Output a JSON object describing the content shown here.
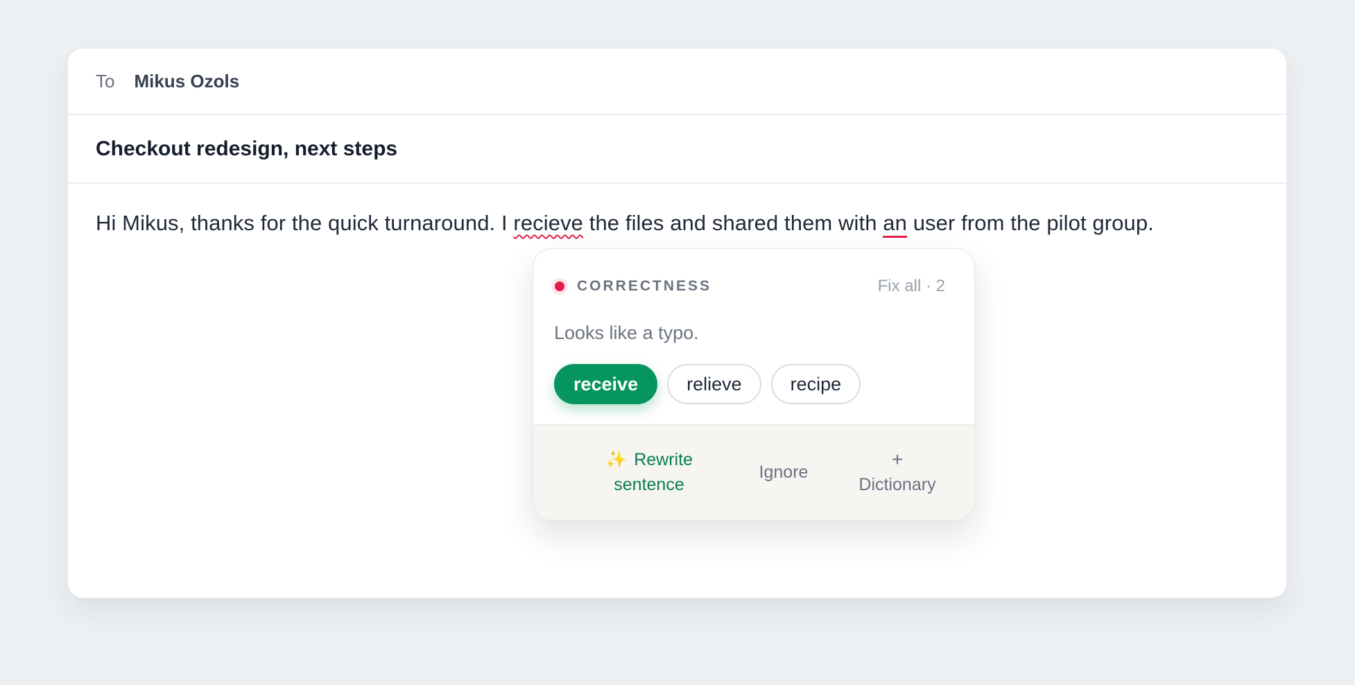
{
  "email": {
    "to_label": "To",
    "recipient": "Mikus Ozols",
    "subject": "Checkout redesign, next steps",
    "body": {
      "part1": "Hi Mikus, thanks for the quick turnaround. I ",
      "misspelled_word": "recieve",
      "part2": " the files and shared them with ",
      "grammar_word": "an",
      "part3": " user from the pilot group."
    }
  },
  "suggestion_card": {
    "category": "CORRECTNESS",
    "category_color": "#e11d48",
    "fix_all": "Fix all · 2",
    "hint": "Looks like a typo.",
    "suggestions": [
      "receive",
      "relieve",
      "recipe"
    ],
    "primary_color": "#07955f",
    "actions": {
      "rewrite_icon": "✨",
      "rewrite_label": "Rewrite sentence",
      "ignore_label": "Ignore",
      "dictionary_icon": "+",
      "dictionary_label": "Dictionary"
    }
  }
}
